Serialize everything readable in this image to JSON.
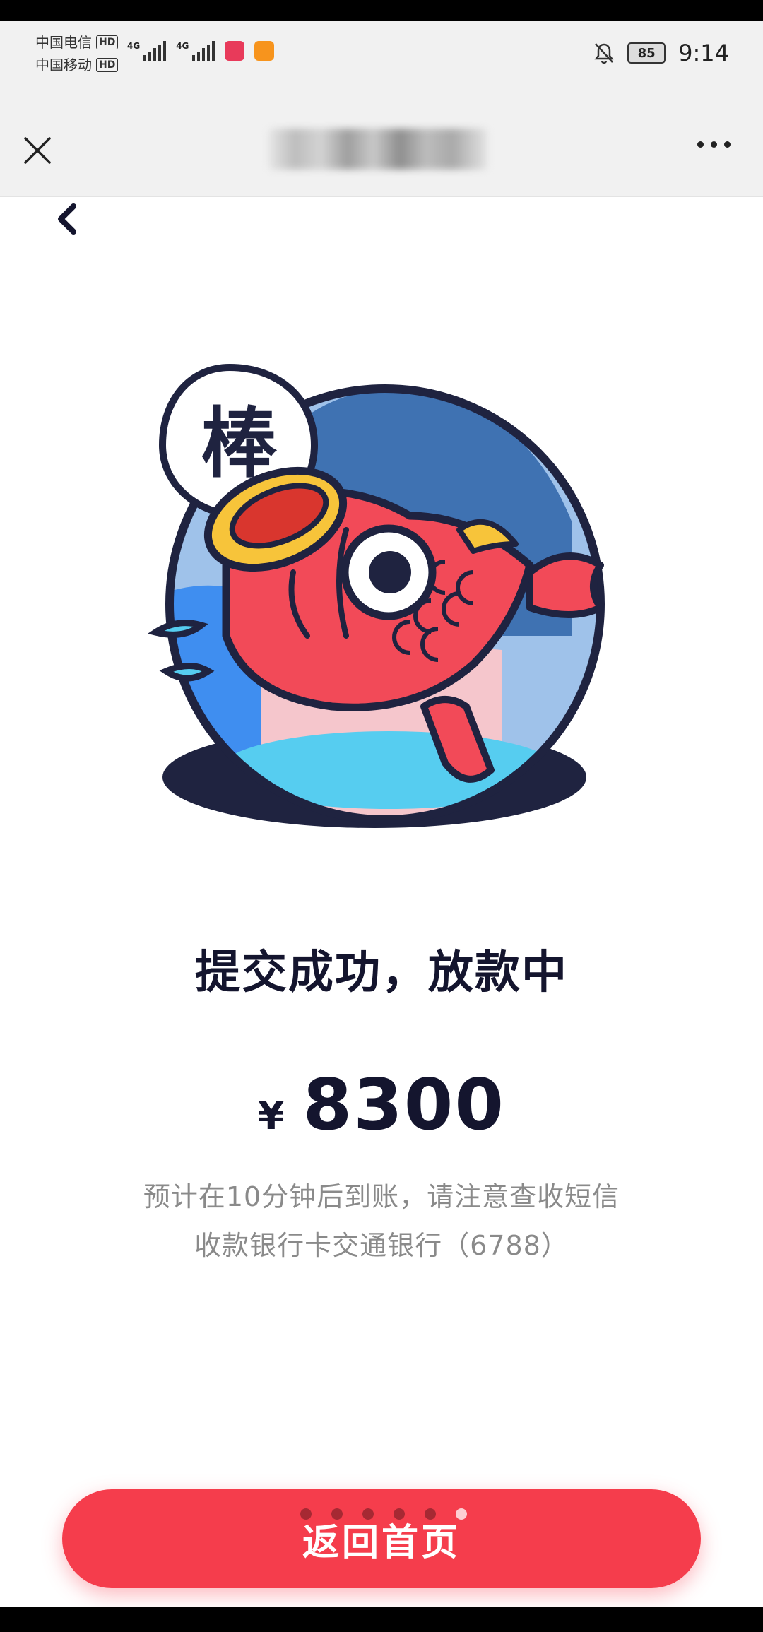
{
  "status_bar": {
    "carrier_1": "中国电信",
    "carrier_2": "中国移动",
    "hd_label": "HD",
    "network_1": "4G",
    "network_2": "4G",
    "battery_level": "85",
    "time": "9:14"
  },
  "page": {
    "badge_text": "棒",
    "title": "提交成功，放款中",
    "currency_symbol": "¥",
    "amount": "8300",
    "note_line1": "预计在10分钟后到账，请注意查收短信",
    "note_line2": "收款银行卡交通银行（6788）"
  },
  "footer": {
    "home_button_label": "返回首页",
    "pager_dot_count": 6,
    "pager_active_index": 5
  },
  "colors": {
    "accent_red": "#f53d4c",
    "title_text": "#14152e",
    "note_text": "#8a8a8a"
  }
}
